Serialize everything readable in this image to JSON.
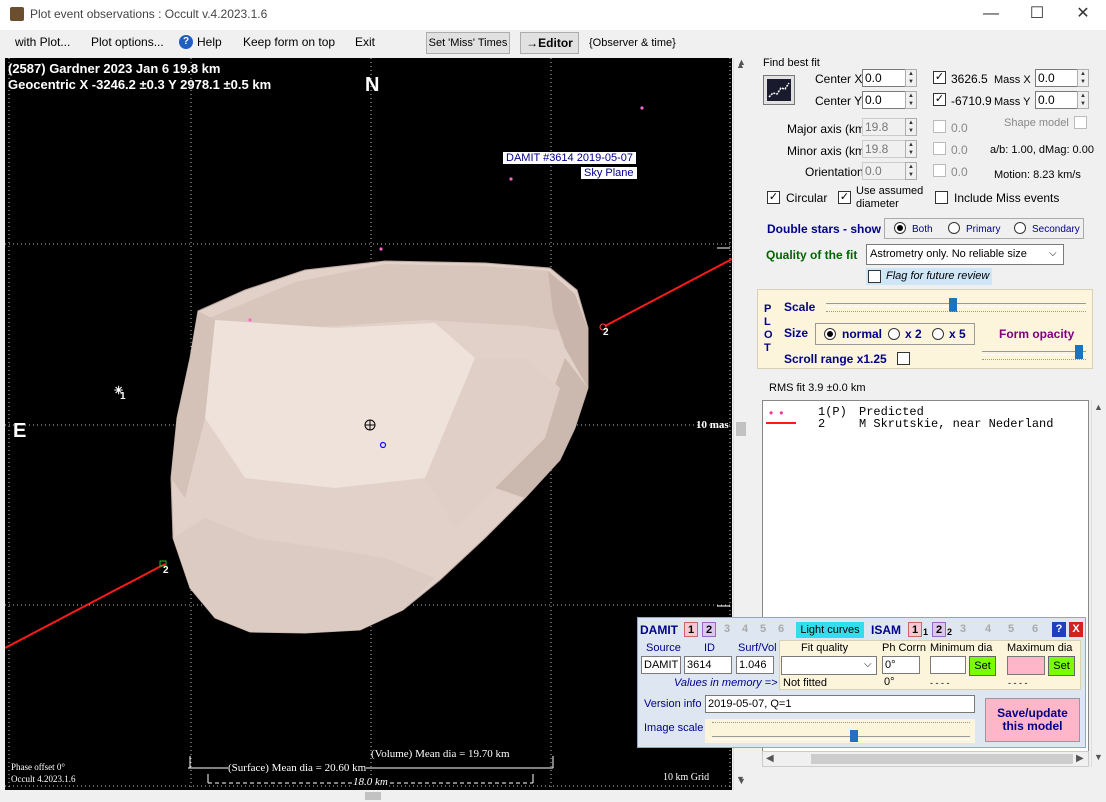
{
  "window": {
    "title": "Plot event observations : Occult v.4.2023.1.6",
    "minimize": "—",
    "maximize": "☐",
    "close": "✕"
  },
  "menu": {
    "with_plot": "with Plot...",
    "plot_options": "Plot options...",
    "help": "Help",
    "keep_on_top": "Keep form on top",
    "exit": "Exit",
    "set_miss": "Set 'Miss' Times",
    "editor": "→Editor",
    "observer_time": "{Observer & time}"
  },
  "plot": {
    "header1": "(2587) Gardner  2023 Jan 6   19.8 km",
    "header2": "Geocentric  X  -3246.2 ±0.3  Y 2978.1 ±0.5 km",
    "north": "N",
    "east": "E",
    "damit_label": "DAMIT #3614 2019-05-07",
    "sky_plane": "Sky Plane",
    "mas_label": "10 mas",
    "chord_label_right": "2",
    "chord_label_left": "2",
    "marker_label_1": "1",
    "volume_dia": "(Volume) Mean dia = 19.70 km",
    "surface_dia": "(Surface) Mean dia = 20.60 km",
    "scale_km": "18.0 km",
    "phase_offset": "Phase offset 0°",
    "version": "Occult 4.2023.1.6",
    "grid": "10 km Grid"
  },
  "fit": {
    "find_best_fit": "Find best fit",
    "center_x_label": "Center X",
    "center_x": "0.0",
    "center_y_label": "Center Y",
    "center_y": "0.0",
    "x_value": "3626.5",
    "y_value": "-6710.9",
    "mass_x_label": "Mass X",
    "mass_x": "0.0",
    "mass_y_label": "Mass Y",
    "mass_y": "0.0",
    "major_label": "Major axis (km)",
    "major": "19.8",
    "major_adj": "0.0",
    "minor_label": "Minor axis (km)",
    "minor": "19.8",
    "minor_adj": "0.0",
    "orient_label": "Orientation",
    "orient": "0.0",
    "orient_adj": "0.0",
    "shape_model": "Shape model",
    "ab_dmag": "a/b: 1.00, dMag: 0.00",
    "motion": "Motion: 8.23 km/s",
    "circular": "Circular",
    "use_assumed": "Use assumed",
    "diameter": "diameter",
    "include_miss": "Include Miss events",
    "double_stars": "Double stars - show",
    "both": "Both",
    "primary": "Primary",
    "secondary": "Secondary",
    "quality_label": "Quality of the fit",
    "quality_value": "Astrometry only. No reliable size",
    "flag_review": "Flag for future review"
  },
  "plotpanel": {
    "letters": [
      "P",
      "L",
      "O",
      "T"
    ],
    "scale": "Scale",
    "size": "Size",
    "normal": "normal",
    "x2": "x 2",
    "x5": "x 5",
    "form_opacity": "Form opacity",
    "scroll_range": "Scroll range x1.25",
    "scale_slider": 0.49,
    "opacity_slider": 0.97
  },
  "rms": "RMS fit 3.9 ±0.0 km",
  "legend": {
    "row1_num": "1(P)",
    "row1_text": "Predicted",
    "row2_num": "2",
    "row2_text": "M Skrutskie, near Nederland"
  },
  "damit": {
    "title": "DAMIT",
    "nums": [
      "1",
      "2",
      "3",
      "4",
      "5",
      "6"
    ],
    "light_curves": "Light curves",
    "isam": "ISAM",
    "isam_nums": [
      "1",
      "1",
      "2",
      "2",
      "3",
      "4",
      "5",
      "6"
    ],
    "help": "?",
    "close": "X",
    "source_label": "Source",
    "id_label": "ID",
    "surfvol_label": "Surf/Vol",
    "source": "DAMIT",
    "id": "3614",
    "surfvol": "1.046",
    "fit_quality": "Fit quality",
    "ph_corrn": "Ph Corrn",
    "ph_value": "0°",
    "min_dia": "Minimum dia",
    "max_dia": "Maximum dia",
    "set": "Set",
    "values_in_memory": "Values in memory =>",
    "not_fitted": "Not fitted",
    "ph_memory": "0°",
    "dash1": "- - - -",
    "dash2": "- - - -",
    "version_label": "Version info",
    "version_value": "2019-05-07, Q=1",
    "image_scale": "Image scale",
    "image_scale_value": 0.55,
    "save": "Save/update\nthis model"
  },
  "colors": {
    "chord": "#ff1a1a",
    "model_fill": "#e8d9d2",
    "accent_blue": "#00008b",
    "green_label": "#006400"
  }
}
